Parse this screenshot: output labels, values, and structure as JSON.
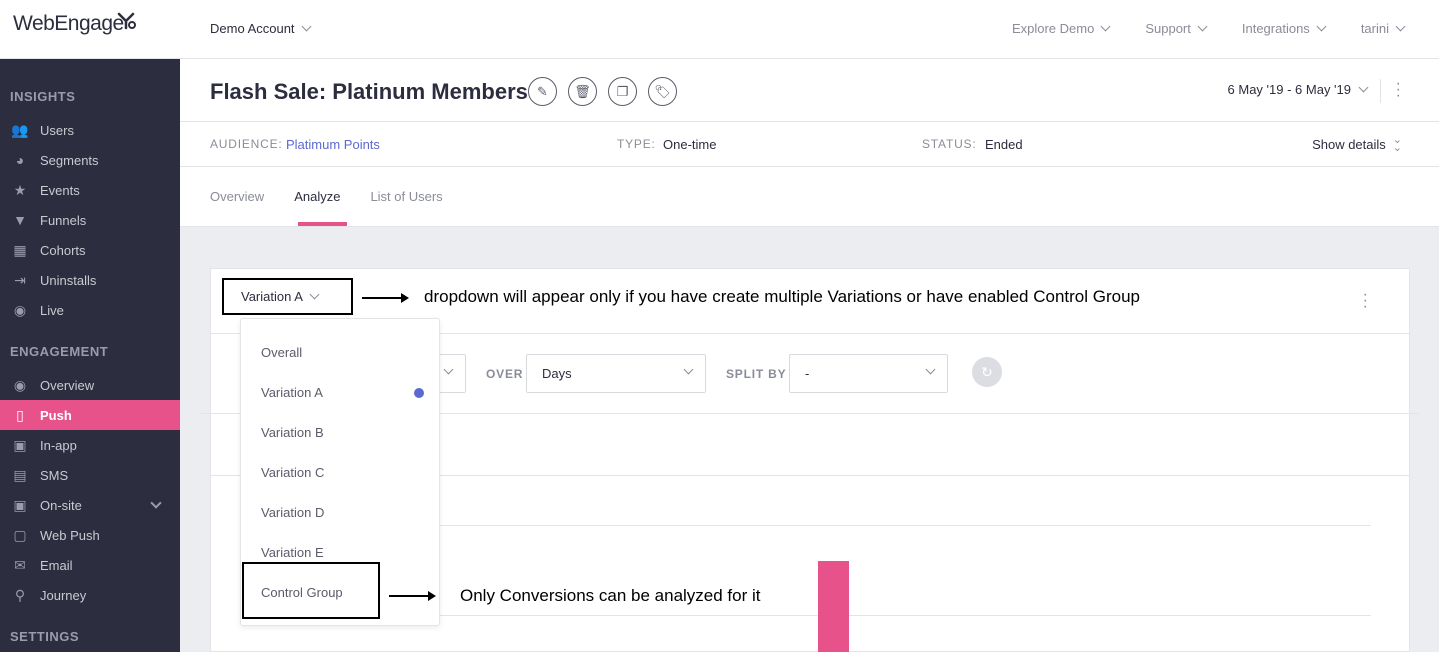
{
  "topbar": {
    "logo": "WebEngage",
    "account": "Demo Account",
    "nav": [
      "Explore Demo",
      "Support",
      "Integrations",
      "tarini"
    ]
  },
  "sidebar": {
    "sections": [
      {
        "title": "INSIGHTS",
        "items": [
          {
            "label": "Users",
            "icon": "users-icon"
          },
          {
            "label": "Segments",
            "icon": "pie-chart-icon"
          },
          {
            "label": "Events",
            "icon": "star-icon"
          },
          {
            "label": "Funnels",
            "icon": "funnel-icon"
          },
          {
            "label": "Cohorts",
            "icon": "grid-icon"
          },
          {
            "label": "Uninstalls",
            "icon": "uninstall-icon"
          },
          {
            "label": "Live",
            "icon": "broadcast-icon"
          }
        ]
      },
      {
        "title": "ENGAGEMENT",
        "items": [
          {
            "label": "Overview",
            "icon": "eye-icon"
          },
          {
            "label": "Push",
            "icon": "mobile-icon",
            "active": true
          },
          {
            "label": "In-app",
            "icon": "in-app-icon"
          },
          {
            "label": "SMS",
            "icon": "chat-icon"
          },
          {
            "label": "On-site",
            "icon": "browser-icon",
            "expandable": true
          },
          {
            "label": "Web Push",
            "icon": "web-push-icon"
          },
          {
            "label": "Email",
            "icon": "envelope-icon"
          },
          {
            "label": "Journey",
            "icon": "rocket-icon"
          }
        ]
      },
      {
        "title": "SETTINGS",
        "items": []
      }
    ],
    "active_color": "#e8528a"
  },
  "header": {
    "title": "Flash Sale: Platinum Members",
    "action_icons": [
      "pencil-icon",
      "trash-icon",
      "copy-icon",
      "tag-icon"
    ],
    "date_range": "6 May '19 - 6 May '19",
    "audience_label": "AUDIENCE:",
    "audience_value": "Platimum Points",
    "type_label": "TYPE:",
    "type_value": "One-time",
    "status_label": "STATUS:",
    "status_value": "Ended",
    "show_details": "Show details",
    "tabs": [
      "Overview",
      "Analyze",
      "List of Users"
    ],
    "active_tab": "Analyze"
  },
  "analysis": {
    "variation_selected": "Variation A",
    "annotation_dropdown": "dropdown will appear only if you have create multiple Variations or have enabled Control Group",
    "annotation_control": "Only Conversions can be analyzed for it",
    "over_label": "OVER",
    "over_value": "Days",
    "split_label": "SPLIT BY",
    "split_value": "-",
    "dropdown_options": [
      "Overall",
      "Variation A",
      "Variation B",
      "Variation C",
      "Variation D",
      "Variation E",
      "Control Group"
    ],
    "selected_option": "Variation A",
    "accent": "#e8528a",
    "selected_dot_color": "#5b6ad0"
  }
}
